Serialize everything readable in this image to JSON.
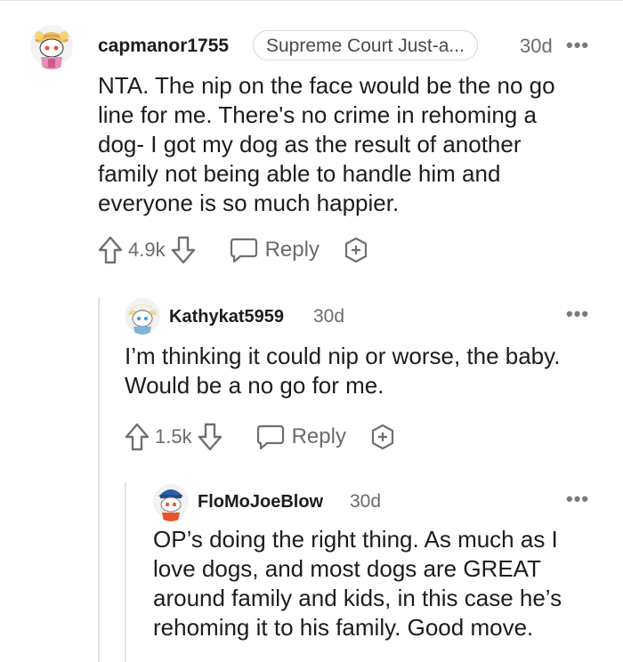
{
  "comments": [
    {
      "username": "capmanor1755",
      "flair": "Supreme Court Just-a...",
      "time": "30d",
      "more": "•••",
      "lines": [
        "NTA. The nip on the face would be the no go",
        "line for me. There's no crime in rehoming a",
        "dog- I got my dog as the result of another",
        "family not being able to handle him and",
        "everyone is so much happier."
      ],
      "votes": "4.9k",
      "reply_label": "Reply"
    },
    {
      "username": "Kathykat5959",
      "time": "30d",
      "more": "•••",
      "lines": [
        "I’m thinking it could nip or worse, the baby.",
        "Would be a no go for me."
      ],
      "votes": "1.5k",
      "reply_label": "Reply"
    },
    {
      "username": "FloMoJoeBlow",
      "time": "30d",
      "more": "•••",
      "lines": [
        "OP’s doing the right thing. As much as I",
        "love dogs, and most dogs are GREAT",
        "around family and kids, in this case he’s",
        "rehoming it to his family. Good move."
      ]
    }
  ]
}
